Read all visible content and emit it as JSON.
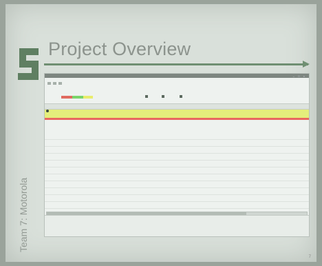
{
  "slide": {
    "logo_letter": "S",
    "title": "Project Overview",
    "side_label": "Team 7: Motorola",
    "page_number": "7"
  },
  "colors": {
    "accent_green": "#6f8f72",
    "row_yellow": "#e4ef7b",
    "row_red": "#e9675f",
    "chip_red": "#e06a5f",
    "chip_green": "#79d46a",
    "chip_yellow": "#e8ec6c"
  },
  "app": {
    "window_title": "",
    "filter_label": "",
    "options": [
      {
        "icon": "checkbox-icon",
        "label": ""
      },
      {
        "icon": "checkbox-icon",
        "label": ""
      },
      {
        "icon": "checkbox-icon",
        "label": ""
      }
    ],
    "columns": [
      "",
      "",
      "",
      "",
      "",
      "",
      "",
      "",
      "",
      "",
      ""
    ],
    "rows": [
      {
        "status": "yellow",
        "cells": [
          "",
          "",
          "",
          "",
          "",
          "",
          "",
          "",
          "",
          "",
          ""
        ]
      },
      {
        "status": "yellow",
        "cells": [
          "",
          "",
          "",
          "",
          "",
          "",
          "",
          "",
          "",
          "",
          ""
        ]
      },
      {
        "status": "red",
        "cells": [
          "",
          "",
          "",
          "",
          "",
          "",
          "",
          "",
          "",
          "",
          ""
        ]
      }
    ]
  }
}
